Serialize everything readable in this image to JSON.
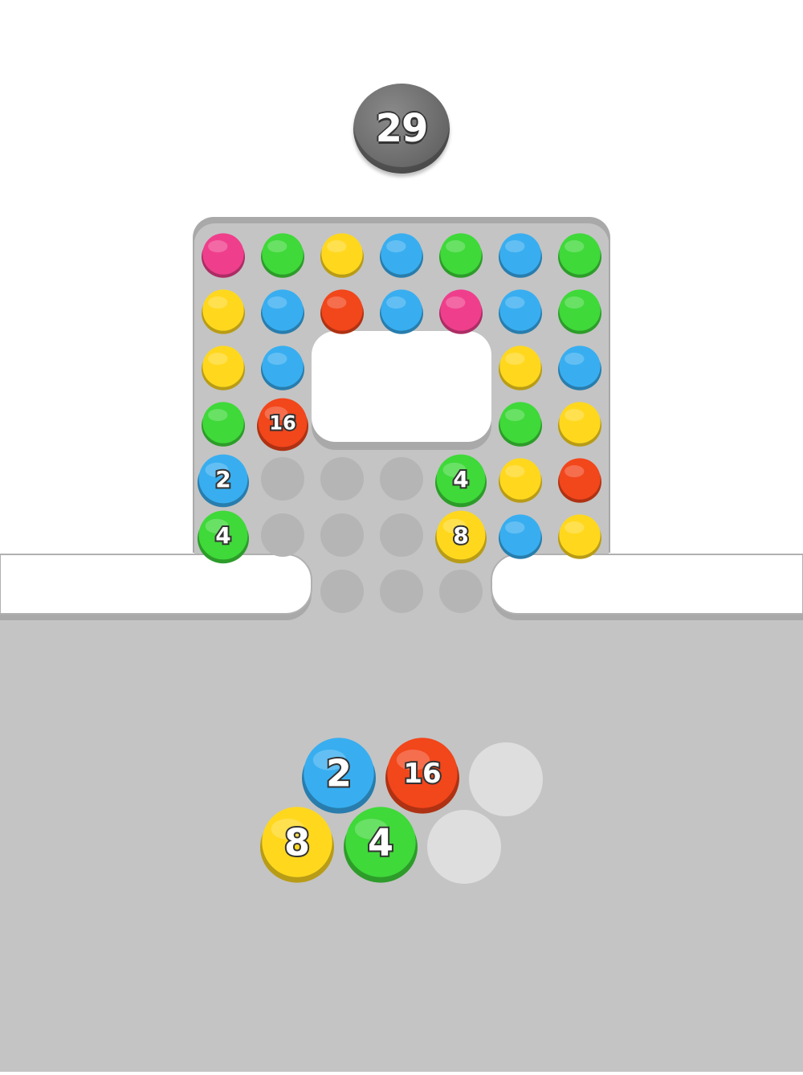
{
  "counter": {
    "value": "29"
  },
  "colors": {
    "pink": "#ef3f8c",
    "green": "#3fd93a",
    "yellow": "#ffd81e",
    "blue": "#38aef0",
    "red": "#f2461b",
    "gray": "#6e6e6e",
    "board": "#c4c4c4",
    "empty_hole": "#b5b5b5",
    "empty_tray": "#dedede"
  },
  "grid": {
    "rows": [
      [
        {
          "color": "pink"
        },
        {
          "color": "green"
        },
        {
          "color": "yellow"
        },
        {
          "color": "blue"
        },
        {
          "color": "green"
        },
        {
          "color": "blue"
        },
        {
          "color": "green"
        }
      ],
      [
        {
          "color": "yellow"
        },
        {
          "color": "blue"
        },
        {
          "color": "red"
        },
        {
          "color": "blue"
        },
        {
          "color": "pink"
        },
        {
          "color": "blue"
        },
        {
          "color": "green"
        }
      ],
      [
        {
          "color": "yellow"
        },
        {
          "color": "blue"
        },
        null,
        null,
        null,
        {
          "color": "yellow"
        },
        {
          "color": "blue"
        }
      ],
      [
        {
          "color": "green"
        },
        {
          "color": "red",
          "label": "16"
        },
        null,
        null,
        null,
        {
          "color": "green"
        },
        {
          "color": "yellow"
        }
      ],
      [
        {
          "color": "blue",
          "label": "2"
        },
        {
          "empty": true
        },
        {
          "empty": true
        },
        {
          "empty": true
        },
        {
          "color": "green",
          "label": "4"
        },
        {
          "color": "yellow"
        },
        {
          "color": "red"
        }
      ],
      [
        {
          "color": "green",
          "label": "4"
        },
        {
          "empty": true
        },
        {
          "empty": true
        },
        {
          "empty": true
        },
        {
          "color": "yellow",
          "label": "8"
        },
        {
          "color": "blue"
        },
        {
          "color": "yellow"
        }
      ],
      [
        null,
        null,
        {
          "empty": true
        },
        {
          "empty": true
        },
        {
          "empty": true
        },
        null,
        null
      ]
    ]
  },
  "tray": {
    "slots": [
      {
        "color": "blue",
        "label": "2"
      },
      {
        "color": "red",
        "label": "16"
      },
      {
        "empty": true
      },
      {
        "color": "yellow",
        "label": "8"
      },
      {
        "color": "green",
        "label": "4"
      },
      {
        "empty": true
      }
    ]
  }
}
